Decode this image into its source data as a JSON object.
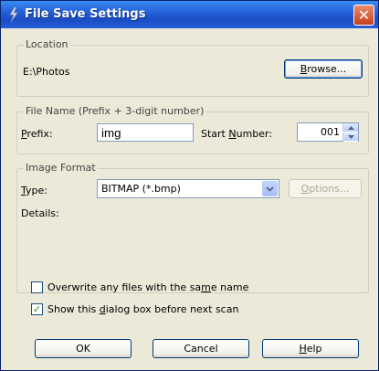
{
  "window": {
    "title": "File Save Settings",
    "close_glyph": "✕"
  },
  "location": {
    "legend": "Location",
    "path": "E:\\Photos",
    "browse_prefix": "",
    "browse_mnemonic": "B",
    "browse_rest": "rowse..."
  },
  "filename": {
    "legend": "File Name (Prefix + 3-digit number)",
    "prefix_mnemonic": "P",
    "prefix_rest": "refix:",
    "prefix_value": "img",
    "start_prefix": "Start ",
    "start_mnemonic": "N",
    "start_rest": "umber:",
    "start_value": "001"
  },
  "format": {
    "legend": "Image Format",
    "type_mnemonic": "T",
    "type_rest": "ype:",
    "type_value": "BITMAP (*.bmp)",
    "options_mnemonic": "O",
    "options_rest": "ptions...",
    "details_label": "Details:"
  },
  "checkboxes": {
    "overwrite_pre": "Overwrite any files with the sa",
    "overwrite_mn": "m",
    "overwrite_post": "e name",
    "overwrite_checked": false,
    "show_pre": "Show this ",
    "show_mn": "d",
    "show_post": "ialog box before next scan",
    "show_checked": true,
    "check_glyph": "✓"
  },
  "buttons": {
    "ok": "OK",
    "cancel": "Cancel",
    "help_mnemonic": "H",
    "help_rest": "elp"
  }
}
